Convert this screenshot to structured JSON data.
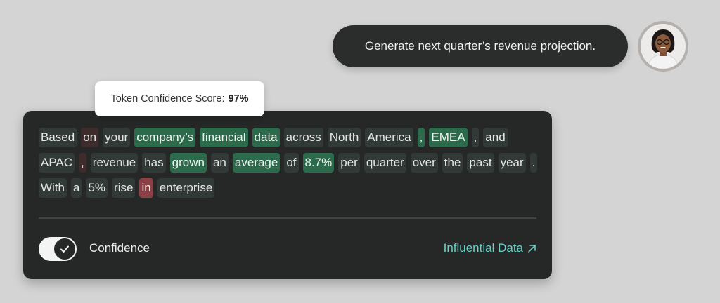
{
  "prompt": {
    "text": "Generate next quarter’s revenue projection."
  },
  "tooltip": {
    "label": "Token Confidence Score:",
    "value": "97%"
  },
  "tokens": [
    {
      "t": "Based",
      "c": "mid"
    },
    {
      "t": "on",
      "c": "low"
    },
    {
      "t": "your",
      "c": "mid"
    },
    {
      "t": "company’s",
      "c": "high"
    },
    {
      "t": "financial",
      "c": "high"
    },
    {
      "t": "data",
      "c": "high"
    },
    {
      "t": "across",
      "c": "mid"
    },
    {
      "t": "North",
      "c": "mid"
    },
    {
      "t": "America",
      "c": "mid"
    },
    {
      "t": ",",
      "c": "high"
    },
    {
      "t": "EMEA",
      "c": "high"
    },
    {
      "t": ",",
      "c": "mid"
    },
    {
      "t": "and",
      "c": "mid"
    },
    {
      "t": "APAC",
      "c": "mid"
    },
    {
      "t": ",",
      "c": "low"
    },
    {
      "t": "revenue",
      "c": "mid"
    },
    {
      "t": "has",
      "c": "mid"
    },
    {
      "t": "grown",
      "c": "high"
    },
    {
      "t": "an",
      "c": "mid"
    },
    {
      "t": "average",
      "c": "high"
    },
    {
      "t": "of",
      "c": "mid"
    },
    {
      "t": "8.7%",
      "c": "high"
    },
    {
      "t": "per",
      "c": "mid"
    },
    {
      "t": "quarter",
      "c": "mid"
    },
    {
      "t": "over",
      "c": "mid"
    },
    {
      "t": "the",
      "c": "mid"
    },
    {
      "t": "past",
      "c": "mid"
    },
    {
      "t": "year",
      "c": "mid"
    },
    {
      "t": ".",
      "c": "mid"
    },
    {
      "t": "With",
      "c": "mid"
    },
    {
      "t": "a",
      "c": "mid"
    },
    {
      "t": "5%",
      "c": "mid"
    },
    {
      "t": "rise",
      "c": "mid"
    },
    {
      "t": "in",
      "c": "vlow"
    },
    {
      "t": "enterprise",
      "c": "mid"
    }
  ],
  "confidence_toggle": {
    "label": "Confidence",
    "on": true
  },
  "influential_link": {
    "label": "Influential Data",
    "icon": "arrow-up-right-icon"
  },
  "colors": {
    "high": "#2c6a4c",
    "mid": "#313a36",
    "low": "#3e2c2c",
    "vlow": "#8c3f44",
    "link": "#66d2c8"
  }
}
